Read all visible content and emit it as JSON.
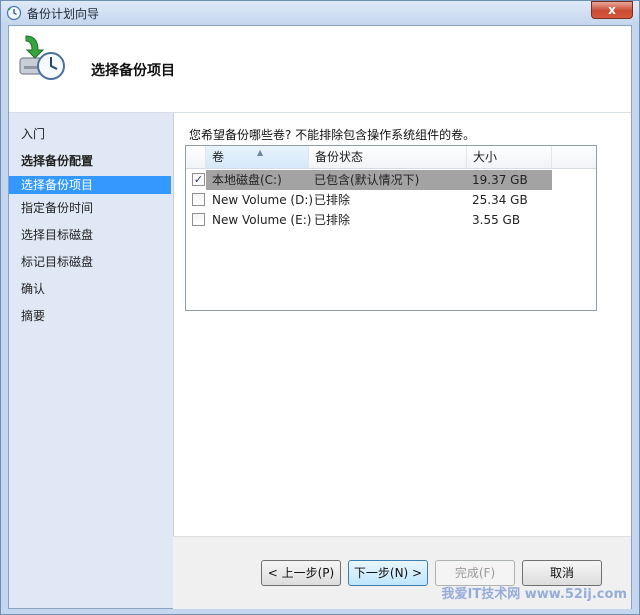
{
  "window": {
    "title": "备份计划向导",
    "icon": "backup-clock-icon",
    "close_label": "x"
  },
  "header": {
    "title": "选择备份项目",
    "icon": "backup-drive-clock-icon"
  },
  "sidebar": {
    "items": [
      {
        "label": "入门"
      },
      {
        "label": "选择备份配置"
      },
      {
        "label": "选择备份项目"
      },
      {
        "label": "指定备份时间"
      },
      {
        "label": "选择目标磁盘"
      },
      {
        "label": "标记目标磁盘"
      },
      {
        "label": "确认"
      },
      {
        "label": "摘要"
      }
    ],
    "selected_index": 2
  },
  "main": {
    "prompt": "您希望备份哪些卷? 不能排除包含操作系统组件的卷。",
    "table": {
      "columns": [
        "卷",
        "备份状态",
        "大小"
      ],
      "rows": [
        {
          "checked": true,
          "checkmark": "✓",
          "volume": "本地磁盘(C:)",
          "status": "已包含(默认情况下)",
          "size": "19.37 GB"
        },
        {
          "checked": false,
          "checkmark": "",
          "volume": "New Volume (D:)",
          "status": "已排除",
          "size": "25.34 GB"
        },
        {
          "checked": false,
          "checkmark": "",
          "volume": "New Volume (E:)",
          "status": "已排除",
          "size": "3.55 GB"
        }
      ]
    }
  },
  "footer": {
    "prev_label": "< 上一步(P)",
    "next_label": "下一步(N) >",
    "finish_label": "完成(F)",
    "cancel_label": "取消"
  },
  "watermark": "我爱IT技术网 www.52ij.com",
  "colors": {
    "selection": "#3399ff",
    "row_highlight": "#a3a3a3",
    "sidebar_bg": "#dfe8f4",
    "frame": "#c5d7ee"
  }
}
